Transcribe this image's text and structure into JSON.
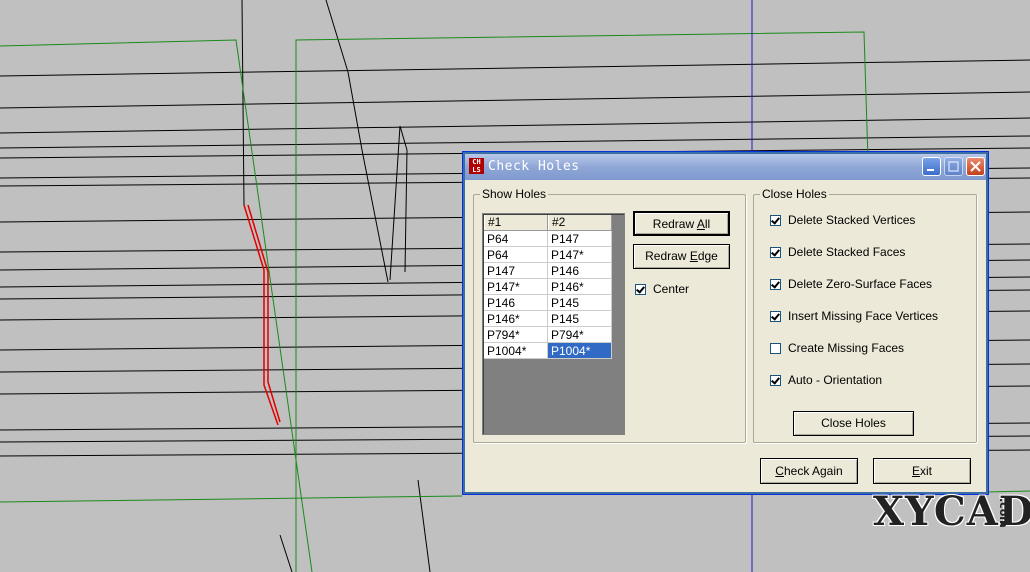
{
  "window": {
    "title": "Check Holes"
  },
  "show_holes": {
    "label": "Show Holes",
    "columns": [
      "#1",
      "#2"
    ],
    "rows": [
      [
        "P64",
        "P147"
      ],
      [
        "P64",
        "P147*"
      ],
      [
        "P147",
        "P146"
      ],
      [
        "P147*",
        "P146*"
      ],
      [
        "P146",
        "P145"
      ],
      [
        "P146*",
        "P145"
      ],
      [
        "P794*",
        "P794*"
      ],
      [
        "P1004*",
        "P1004*"
      ]
    ],
    "selected_cell": "P1004*",
    "redraw_all": {
      "pre": "Redraw ",
      "key": "A",
      "post": "ll"
    },
    "redraw_edge": {
      "pre": "Redraw ",
      "key": "E",
      "post": "dge"
    },
    "center": {
      "label": "Center",
      "checked": true
    }
  },
  "close_holes": {
    "label": "Close Holes",
    "options": [
      {
        "label": "Delete Stacked Vertices",
        "checked": true
      },
      {
        "label": "Delete Stacked Faces",
        "checked": true
      },
      {
        "label": "Delete Zero-Surface Faces",
        "checked": true
      },
      {
        "label": "Insert Missing Face Vertices",
        "checked": true
      },
      {
        "label": "Create Missing Faces",
        "checked": false
      },
      {
        "label": "Auto - Orientation",
        "checked": true
      }
    ],
    "button": "Close Holes"
  },
  "footer": {
    "check_again": {
      "key": "C",
      "post": "heck Again"
    },
    "exit": {
      "key": "E",
      "post": "xit"
    }
  },
  "watermark": {
    "logo": "XYCAD",
    "suffix": ".com"
  },
  "colors": {
    "background": "#c0c0c0",
    "title_gradient_start": "#b7c7e8",
    "title_gradient_end": "#7f99cf",
    "selection": "#316ac5",
    "hole_edge": "#e00000",
    "green_lines": "#1a8a1a",
    "axis_line": "#1b1bd0"
  }
}
